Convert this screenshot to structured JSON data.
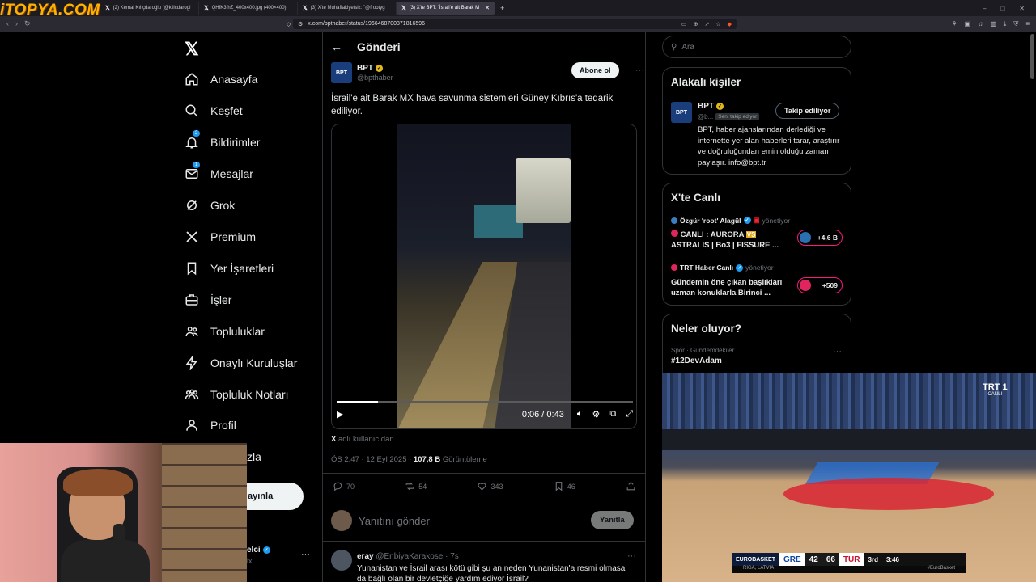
{
  "watermark": "iTOPYA.COM",
  "browser": {
    "tabs": [
      {
        "label": "(2) Kemal Kılıçdaroğlu (@kilicdarogl"
      },
      {
        "label": "QHfK3fhZ_400x400.jpg (400×400)"
      },
      {
        "label": "(3) X'te Muhaffakiyetsiz: \"@frootyg"
      },
      {
        "label": "(3) X'te BPT: \"İsrail'e ait Barak M"
      }
    ],
    "new_tab": "+",
    "url": "x.com/bpthaber/status/1966468700371816596"
  },
  "nav": {
    "items": [
      {
        "label": "Anasayfa"
      },
      {
        "label": "Keşfet"
      },
      {
        "label": "Bildirimler",
        "badge": "2"
      },
      {
        "label": "Mesajlar",
        "badge": "1"
      },
      {
        "label": "Grok"
      },
      {
        "label": "Premium"
      },
      {
        "label": "Yer İşaretleri"
      },
      {
        "label": "İşler"
      },
      {
        "label": "Topluluklar"
      },
      {
        "label": "Onaylı Kuruluşlar"
      },
      {
        "label": "Topluluk Notları"
      },
      {
        "label": "Profil"
      }
    ],
    "more_partial": "zla",
    "post_partial": "ayınla",
    "account": {
      "name_partial": "elci",
      "handle_partial": "ixi"
    }
  },
  "post": {
    "header_title": "Gönderi",
    "author": {
      "avatar_text": "BPT",
      "name": "BPT",
      "handle": "@bpthaber"
    },
    "subscribe_label": "Abone ol",
    "text": "İsrail'e ait Barak MX hava savunma sistemleri Güney Kıbrıs'a tedarik ediliyor.",
    "video": {
      "time": "0:06 / 0:43",
      "progress": 0.14
    },
    "source_prefix": "X",
    "source_text": " adlı kullanıcıdan",
    "timestamp": "ÖS 2:47 · 12 Eyl 2025 · ",
    "views_count": "107,8 B",
    "views_label": " Görüntüleme",
    "stats": {
      "replies": "70",
      "reposts": "54",
      "likes": "343",
      "bookmarks": "46"
    },
    "reply_placeholder": "Yanıtını gönder",
    "reply_button": "Yanıtla"
  },
  "reply": {
    "name": "eray",
    "handle": "@EnbiyaKarakose · 7s",
    "text": "Yunanistan ve İsrail arası kötü gibi şu an neden Yunanistan'a resmi olmasa da bağlı olan bir devletçiğe yardım ediyor İsrail?"
  },
  "sidebar": {
    "search_placeholder": "Ara",
    "relevant": {
      "title": "Alakalı kişiler",
      "name": "BPT",
      "avatar_text": "BPT",
      "handle": "@b...",
      "follows_you": "Seni takip ediyor",
      "follow_label": "Takip ediliyor",
      "bio": "BPT, haber ajanslarından derlediği ve internette yer alan haberleri tarar, araştırır ve doğruluğundan emin olduğu zaman paylaşır. info@bpt.tr"
    },
    "live": {
      "title": "X'te Canlı",
      "items": [
        {
          "host": "Özgür 'root' Alagül",
          "role": "yönetiyor",
          "title_a": "CANLI : AURORA ",
          "vs": "VS",
          "title_b": " ASTRALIS | Bo3 | FISSURE ...",
          "count": "+4,6 B"
        },
        {
          "host": "TRT Haber Canlı",
          "role": "yönetiyor",
          "title": "Gündemin öne çıkan başlıkları uzman konuklarla Birinci ...",
          "count": "+509"
        }
      ]
    },
    "trends": {
      "title": "Neler oluyor?",
      "category": "Spor · Gündemdekiler",
      "tag": "#12DevAdam"
    }
  },
  "broadcast": {
    "channel": "TRT 1",
    "channel_sub": "CANLI",
    "league": "EUROBASKET",
    "team_a": "GRE",
    "score_a": "42",
    "score_b": "66",
    "team_b": "TUR",
    "quarter": "3rd",
    "clock": "3:46",
    "venue": "RIGA, LATVIA",
    "hashtag": "#EuroBasket"
  }
}
